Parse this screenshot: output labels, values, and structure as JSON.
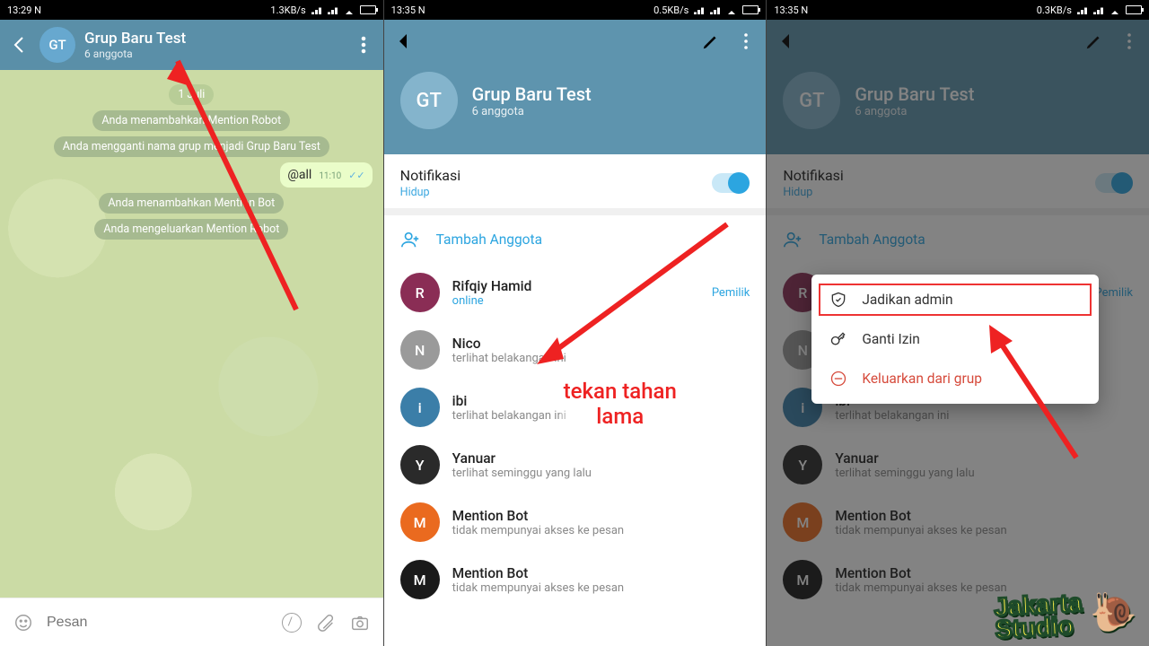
{
  "status": {
    "time1": "13:29 N",
    "time2": "13:35 N",
    "rate1": "1.3KB/s",
    "rate2": "0.5KB/s",
    "rate3": "0.3KB/s"
  },
  "group": {
    "avatar": "GT",
    "title": "Grup Baru Test",
    "subtitle": "6 anggota"
  },
  "chat": {
    "date_chip": "1 Juli",
    "sys1": "Anda menambahkan Mention Robot",
    "sys2": "Anda mengganti nama grup menjadi Grup Baru Test",
    "msg_all": "@all",
    "msg_time": "11:10",
    "sys3": "Anda menambahkan Mention Bot",
    "sys4": "Anda mengeluarkan Mention Robot",
    "input_placeholder": "Pesan"
  },
  "profile": {
    "notif_label": "Notifikasi",
    "notif_value": "Hidup",
    "add_member": "Tambah Anggota"
  },
  "members": [
    {
      "name": "Rifqiy Hamid",
      "status": "online",
      "online": true,
      "badge": "Pemilik",
      "avbg": "#8a2d55"
    },
    {
      "name": "Nico",
      "status": "terlihat belakangan ini",
      "online": false,
      "badge": "",
      "avbg": "#9a9a9a"
    },
    {
      "name": "ibi",
      "status": "terlihat belakangan ini",
      "online": false,
      "badge": "",
      "avbg": "#3b7ea8"
    },
    {
      "name": "Yanuar",
      "status": "terlihat seminggu yang lalu",
      "online": false,
      "badge": "",
      "avbg": "#2a2a2a"
    },
    {
      "name": "Mention Bot",
      "status": "tidak mempunyai akses ke pesan",
      "online": false,
      "badge": "",
      "avbg": "#ea6a1f"
    },
    {
      "name": "Mention Bot",
      "status": "tidak mempunyai akses ke pesan",
      "online": false,
      "badge": "",
      "avbg": "#1a1a1a"
    }
  ],
  "ctx_menu": {
    "make_admin": "Jadikan admin",
    "change_perm": "Ganti Izin",
    "remove": "Keluarkan dari grup"
  },
  "anno": {
    "press_hold": "tekan tahan\nlama"
  },
  "watermark": {
    "line1": "Jakarta",
    "line2": "Studio"
  }
}
